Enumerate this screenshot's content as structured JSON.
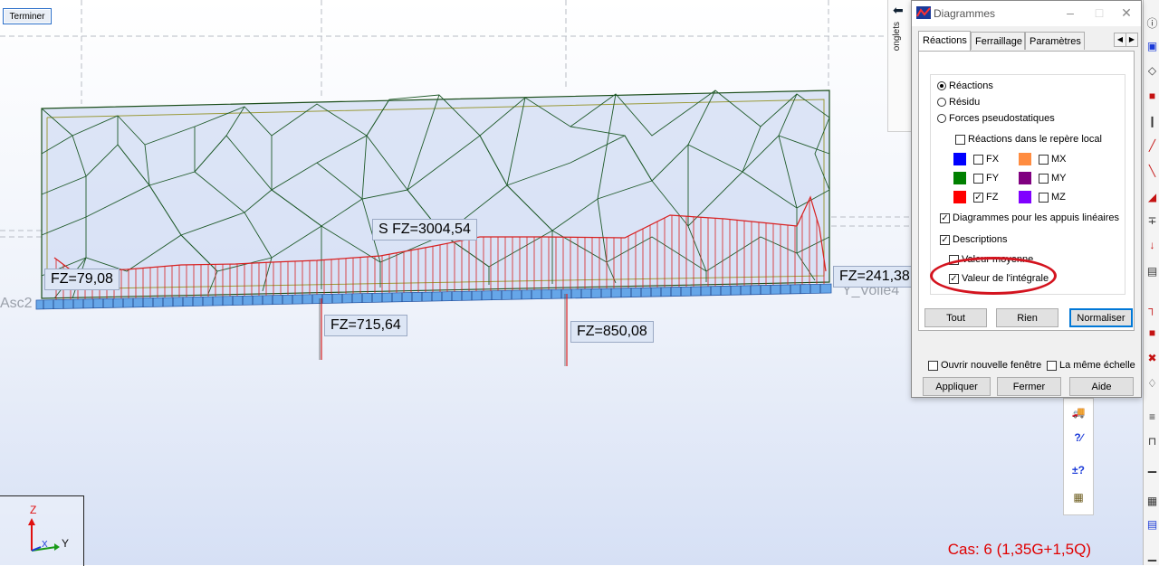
{
  "toolbar": {
    "finish_label": "Terminer"
  },
  "diagram": {
    "labels": {
      "sum": "S  FZ=3004,54",
      "left": "FZ=79,08",
      "right": "FZ=241,38",
      "mid1": "FZ=715,64",
      "mid2": "FZ=850,08"
    },
    "ghost_labels": {
      "asc": "Asc2",
      "voile4": "Y_Voile4"
    }
  },
  "side_tab": {
    "label": "onglets"
  },
  "status": {
    "case": "Cas: 6 (1,35G+1,5Q)"
  },
  "axes": {
    "z": "Z",
    "x": "X",
    "y": "Y"
  },
  "dialog": {
    "title": "Diagrammes",
    "tabs": [
      "Réactions",
      "Ferraillage",
      "Paramètres"
    ],
    "options": {
      "reactions": "Réactions",
      "residu": "Résidu",
      "pseudo": "Forces pseudostatiques",
      "local": "Réactions dans le repère local",
      "fx": "FX",
      "fy": "FY",
      "fz": "FZ",
      "mx": "MX",
      "my": "MY",
      "mz": "MZ",
      "linear": "Diagrammes pour les appuis linéaires",
      "descriptions": "Descriptions",
      "moyenne": "Valeur moyenne",
      "integrale": "Valeur de l'intégrale"
    },
    "colors": {
      "fx": "#0000ff",
      "fy": "#008000",
      "fz": "#ff0000",
      "mx": "#ff8c40",
      "my": "#800080",
      "mz": "#8000ff"
    },
    "checked": {
      "fz": true,
      "linear": true,
      "descriptions": true,
      "integrale": true
    },
    "buttons": {
      "tout": "Tout",
      "rien": "Rien",
      "normaliser": "Normaliser",
      "appliquer": "Appliquer",
      "fermer": "Fermer",
      "aide": "Aide"
    },
    "bottom": {
      "new_window": "Ouvrir nouvelle fenêtre",
      "same_scale": "La même échelle"
    }
  }
}
